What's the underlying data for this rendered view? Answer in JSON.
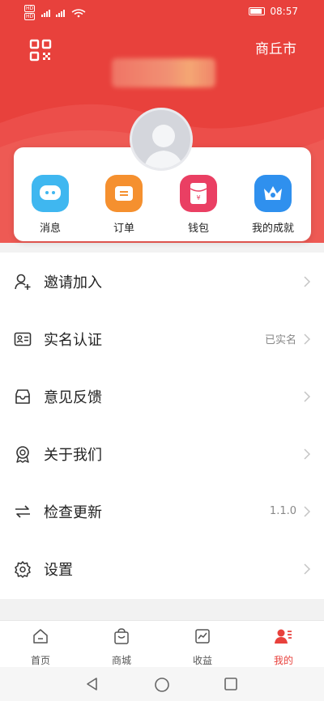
{
  "status_bar": {
    "time": "08:57",
    "sim1": "HD",
    "sim2": "HD"
  },
  "header": {
    "city": "商丘市"
  },
  "quick_actions": [
    {
      "label": "消息",
      "icon": "message-icon",
      "color": "#3fb7f0"
    },
    {
      "label": "订单",
      "icon": "order-icon",
      "color": "#f5902f"
    },
    {
      "label": "钱包",
      "icon": "wallet-icon",
      "color": "#ea3f63"
    },
    {
      "label": "我的成就",
      "icon": "achievement-icon",
      "color": "#2f90ee"
    }
  ],
  "menu": [
    {
      "label": "邀请加入",
      "value": "",
      "icon": "invite-user-icon"
    },
    {
      "label": "实名认证",
      "value": "已实名",
      "icon": "id-card-icon"
    },
    {
      "label": "意见反馈",
      "value": "",
      "icon": "feedback-icon"
    },
    {
      "label": "关于我们",
      "value": "",
      "icon": "about-badge-icon"
    },
    {
      "label": "检查更新",
      "value": "1.1.0",
      "icon": "update-icon"
    },
    {
      "label": "设置",
      "value": "",
      "icon": "settings-gear-icon"
    }
  ],
  "tabs": [
    {
      "label": "首页",
      "icon": "home-icon",
      "active": false
    },
    {
      "label": "商城",
      "icon": "shop-bag-icon",
      "active": false
    },
    {
      "label": "收益",
      "icon": "earnings-chart-icon",
      "active": false
    },
    {
      "label": "我的",
      "icon": "profile-icon",
      "active": true
    }
  ],
  "colors": {
    "brand": "#e8413c",
    "background": "#f2f2f2"
  }
}
